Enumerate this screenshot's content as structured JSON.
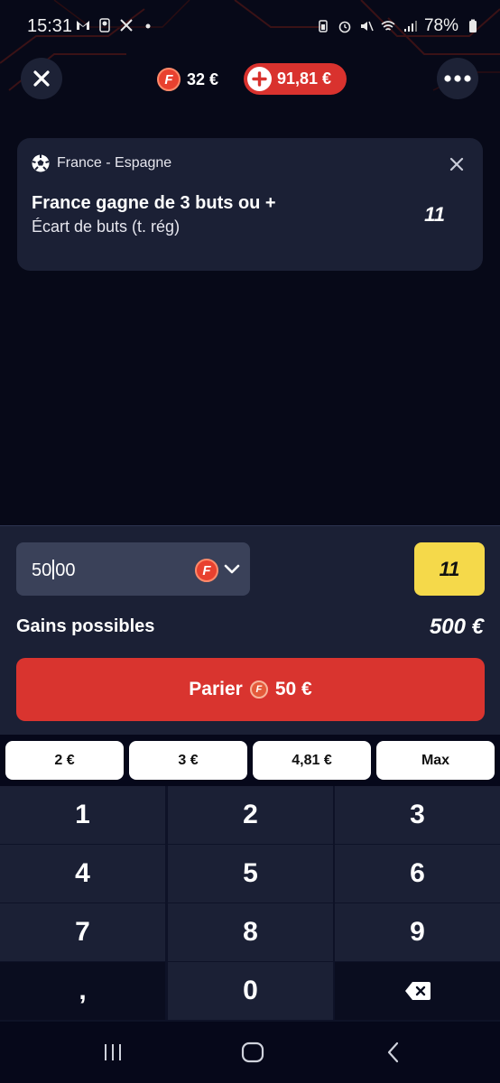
{
  "status_bar": {
    "time": "15:31",
    "battery": "78%"
  },
  "header": {
    "freebet_amount": "32 €",
    "balance": "91,81 €",
    "freebet_coin_letter": "F"
  },
  "bet_card": {
    "match": "France - Espagne",
    "selection": "France gagne de 3 buts ou +",
    "market": "Écart de buts (t. rég)",
    "odds": "11"
  },
  "stake": {
    "value_before_cursor": "50",
    "value_after_cursor": "00",
    "coin_letter": "F"
  },
  "odds_box": "11",
  "gains": {
    "label": "Gains possibles",
    "value": "500 €"
  },
  "bet_button": {
    "label": "Parier",
    "amount": "50 €",
    "coin_letter": "F"
  },
  "quick_amounts": [
    "2 €",
    "3 €",
    "4,81 €",
    "Max"
  ],
  "keypad": {
    "keys": [
      "1",
      "2",
      "3",
      "4",
      "5",
      "6",
      "7",
      "8",
      "9",
      ",",
      "0"
    ]
  },
  "colors": {
    "background": "#06081a",
    "card": "#1b2035",
    "accent_red": "#d9342f",
    "odds_yellow": "#f5d94a",
    "input": "#3a4159"
  },
  "icons": {
    "close": "close-icon",
    "more": "more-dots-icon",
    "add_funds": "plus-icon",
    "sport": "soccer-ball-icon",
    "chevron": "chevron-down-icon",
    "backspace": "backspace-icon"
  }
}
